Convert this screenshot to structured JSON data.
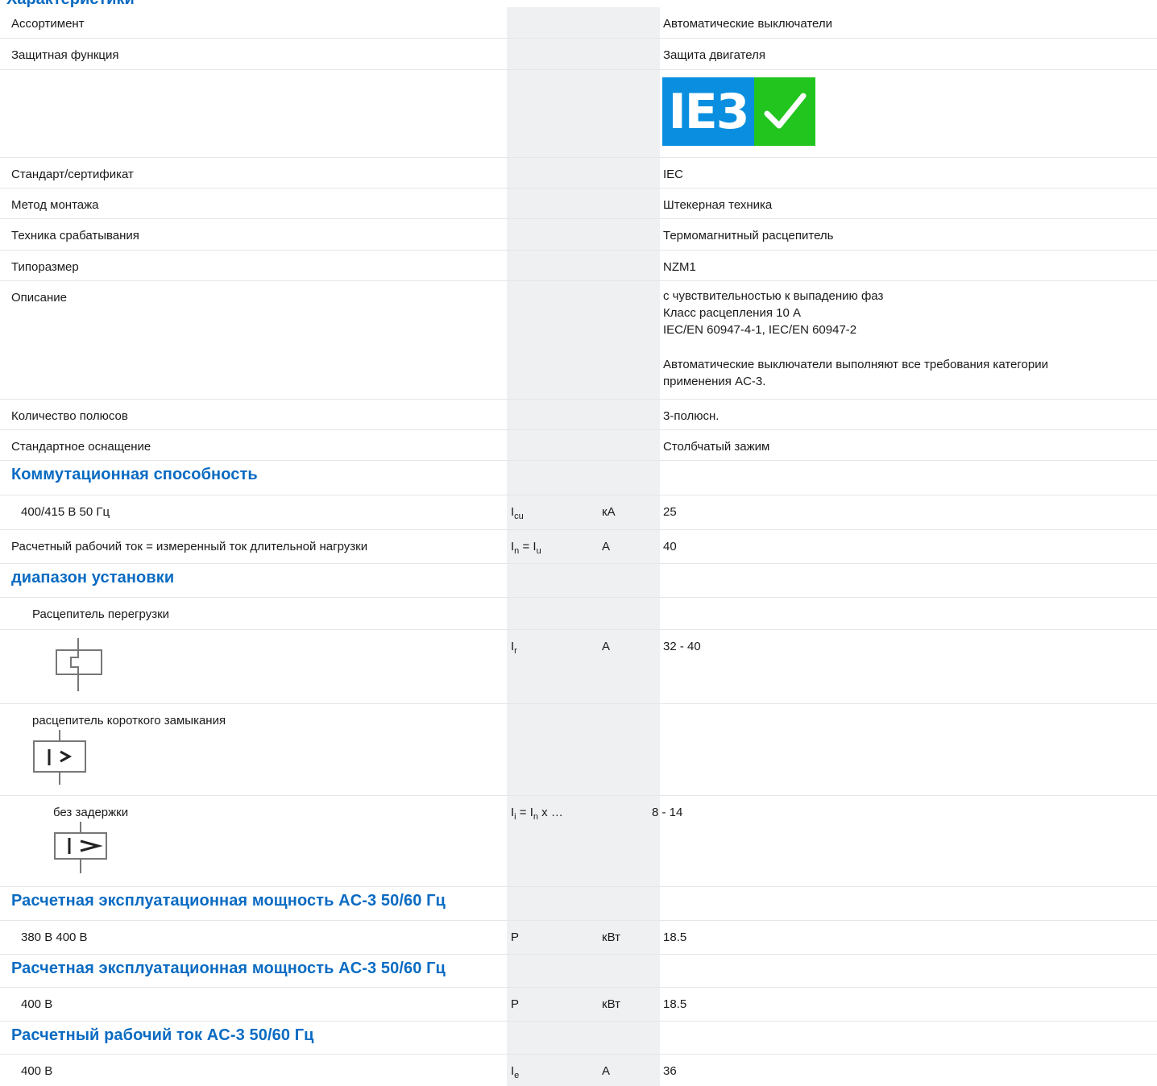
{
  "header": {
    "title_fragment": "Характеристики"
  },
  "colors": {
    "section_blue": "#0a6bc2",
    "symbol_col_shade": "#eef0f2",
    "ie3_blue": "#0a8fe0",
    "ie3_green": "#22c41e"
  },
  "rows": {
    "assortment": {
      "label": "Ассортимент",
      "value": "Автоматические выключатели"
    },
    "protective_function": {
      "label": "Защитная функция",
      "value": "Защита двигателя"
    },
    "badge": {
      "text": "IE3",
      "icon": "checkmark-icon"
    },
    "standard": {
      "label": "Стандарт/сертификат",
      "value": "IEC"
    },
    "mounting": {
      "label": "Метод монтажа",
      "value": "Штекерная техника"
    },
    "tripping": {
      "label": "Техника срабатывания",
      "value": "Термомагнитный расцепитель"
    },
    "frame_size": {
      "label": "Типоразмер",
      "value": "NZM1"
    },
    "description": {
      "label": "Описание",
      "line1": "с чувствительностью к выпадению фаз",
      "line2": "Класс расцепления 10 A",
      "line3": "IEC/EN 60947-4-1, IEC/EN 60947-2",
      "line4": "Автоматические выключатели выполняют все требования категории",
      "line5": "применения AC-3."
    },
    "poles": {
      "label": "Количество полюсов",
      "value": "3-полюсн."
    },
    "standard_equipment": {
      "label": "Стандартное оснащение",
      "value": "Столбчатый зажим"
    }
  },
  "switching": {
    "heading": "Коммутационная способность",
    "row": {
      "label": "400/415 В 50 Гц",
      "sym_main": "I",
      "sym_sub": "cu",
      "unit": "кА",
      "value": "25"
    }
  },
  "rated_current": {
    "label": "Расчетный рабочий ток = измеренный ток длительной нагрузки",
    "sym_main1": "I",
    "sym_sub1": "n",
    "sym_eq": " = I",
    "sym_sub2": "u",
    "unit": "A",
    "value": "40"
  },
  "setting_range": {
    "heading": "диапазон установки",
    "overload": {
      "label": "Расцепитель перегрузки",
      "icon": "thermal-release-icon",
      "sym_main": "I",
      "sym_sub": "r",
      "unit": "A",
      "value": "32 - 40"
    },
    "short_circuit": {
      "label": "расцепитель короткого замыкания",
      "icon": "short-circuit-release-icon"
    },
    "instant": {
      "label": "без задержки",
      "icon": "instantaneous-release-icon",
      "sym_main": "I",
      "sym_sub": "i",
      "sym_eq": " = I",
      "sym_sub2": "n",
      "sym_tail": " x …",
      "value": "8 - 14"
    }
  },
  "power1": {
    "heading": "Расчетная эксплуатационная мощность AC-3 50/60 Гц",
    "row": {
      "label": "380 В 400 В",
      "symbol": "P",
      "unit": "кВт",
      "value": "18.5"
    }
  },
  "power2": {
    "heading": "Расчетная эксплуатационная мощность AC-3 50/60 Гц",
    "row": {
      "label": "400 В",
      "symbol": "P",
      "unit": "кВт",
      "value": "18.5"
    }
  },
  "current_ac3": {
    "heading": "Расчетный рабочий ток AC-3 50/60 Гц",
    "row": {
      "label": "400 В",
      "sym_main": "I",
      "sym_sub": "e",
      "unit": "A",
      "value": "36"
    }
  }
}
